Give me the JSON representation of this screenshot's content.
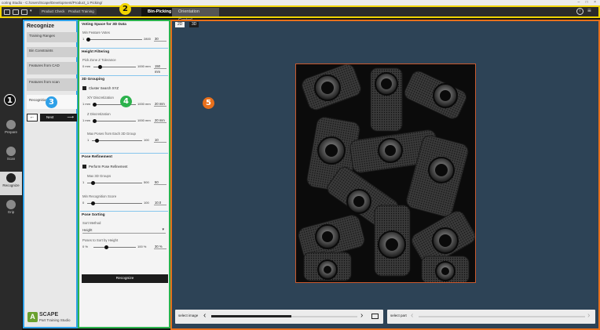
{
  "titlebar": {
    "title": "coring Studio - C:/Users/Scape/Development/Product_1 Picking/",
    "window_buttons": "– □ ×"
  },
  "toolbar": {
    "chips": [
      "Product Check",
      "Product Training"
    ],
    "tabs": [
      {
        "label": "Bin-Picking",
        "active": true
      },
      {
        "label": "Orientation Control",
        "active": false
      }
    ],
    "right_icons": [
      "info-icon",
      "menu-icon"
    ]
  },
  "rail": {
    "items": [
      {
        "label": "Prepare",
        "icon": "prepare-icon",
        "active": false
      },
      {
        "label": "Scan",
        "icon": "scan-icon",
        "active": false
      },
      {
        "label": "Recognize",
        "icon": "recognize-icon",
        "active": true
      },
      {
        "label": "Grip",
        "icon": "grip-icon",
        "active": false
      }
    ]
  },
  "steps": {
    "title": "Recognize",
    "items": [
      {
        "label": "Training Ranges"
      },
      {
        "label": "Bin Constraints"
      },
      {
        "label": "Features from CAD"
      },
      {
        "label": "Features from scan"
      },
      {
        "label": "Recognition"
      }
    ],
    "back_label": "←",
    "next_label": "Next",
    "next_arrow": "⟶"
  },
  "brand": {
    "name": "SCAPE",
    "subtitle": "Part Training Studio",
    "logo_letter": "A"
  },
  "settings": {
    "voting": {
      "title": "Voting Space for 3D Data",
      "min_feature_votes": {
        "label": "Min Feature Votes",
        "min": "1",
        "max": "2800",
        "value": "30",
        "fraction": 0.02
      }
    },
    "height": {
      "title": "Height Filtering",
      "pick_zone": {
        "label": "Pick Zone Z Tolerance",
        "min": "0 mm",
        "max": "1000 mm",
        "value": "150 mm",
        "fraction": 0.15
      }
    },
    "grouping": {
      "title": "3D Grouping",
      "cluster_label": "Cluster Search XYZ",
      "xy": {
        "label": "X/Y Discretization",
        "min": "1 mm",
        "max": "1000 mm",
        "value": "20 mm",
        "fraction": 0.02
      },
      "z": {
        "label": "Z Discretization",
        "min": "1 mm",
        "max": "1000 mm",
        "value": "20 mm",
        "fraction": 0.02
      },
      "max_poses": {
        "label": "Max Poses from Each 3D Group",
        "min": "1",
        "max": "100",
        "value": "10",
        "fraction": 0.09
      }
    },
    "refine": {
      "title": "Pose Refinement",
      "perform_label": "Perform Pose Refinement",
      "max_groups": {
        "label": "Max 3D Groups",
        "min": "1",
        "max": "500",
        "value": "50",
        "fraction": 0.1
      },
      "min_score": {
        "label": "Min Recognition Score",
        "min": "0",
        "max": "100",
        "value": "10.0",
        "fraction": 0.1
      }
    },
    "sorting": {
      "title": "Pose Sorting",
      "method_label": "Sort Method",
      "method_value": "Height",
      "by_height": {
        "label": "Poses to Sort by Height",
        "min": "0 %",
        "max": "100 %",
        "value": "30 %",
        "fraction": 0.3
      }
    },
    "recognize_button": "Recognize"
  },
  "viewer": {
    "tabs": [
      {
        "label": "2D",
        "active": true
      },
      {
        "label": "3D",
        "active": false
      }
    ],
    "image_description_icon": "bin-image",
    "select_image_label": "select image",
    "select_image_progress": 0.55,
    "select_part_label": "select part",
    "prev_arrow": "‹",
    "next_arrow": "›",
    "open_icon": "folder-icon"
  },
  "markers": [
    "1",
    "2",
    "3",
    "4",
    "5"
  ],
  "colors": {
    "toolbar_border": "#f2d500",
    "steps_border": "#2ea0e8",
    "settings_border": "#2bb24c",
    "viewer_border": "#e8701c",
    "viewer_bg": "#2d4356",
    "brand_green": "#6aa12f"
  }
}
